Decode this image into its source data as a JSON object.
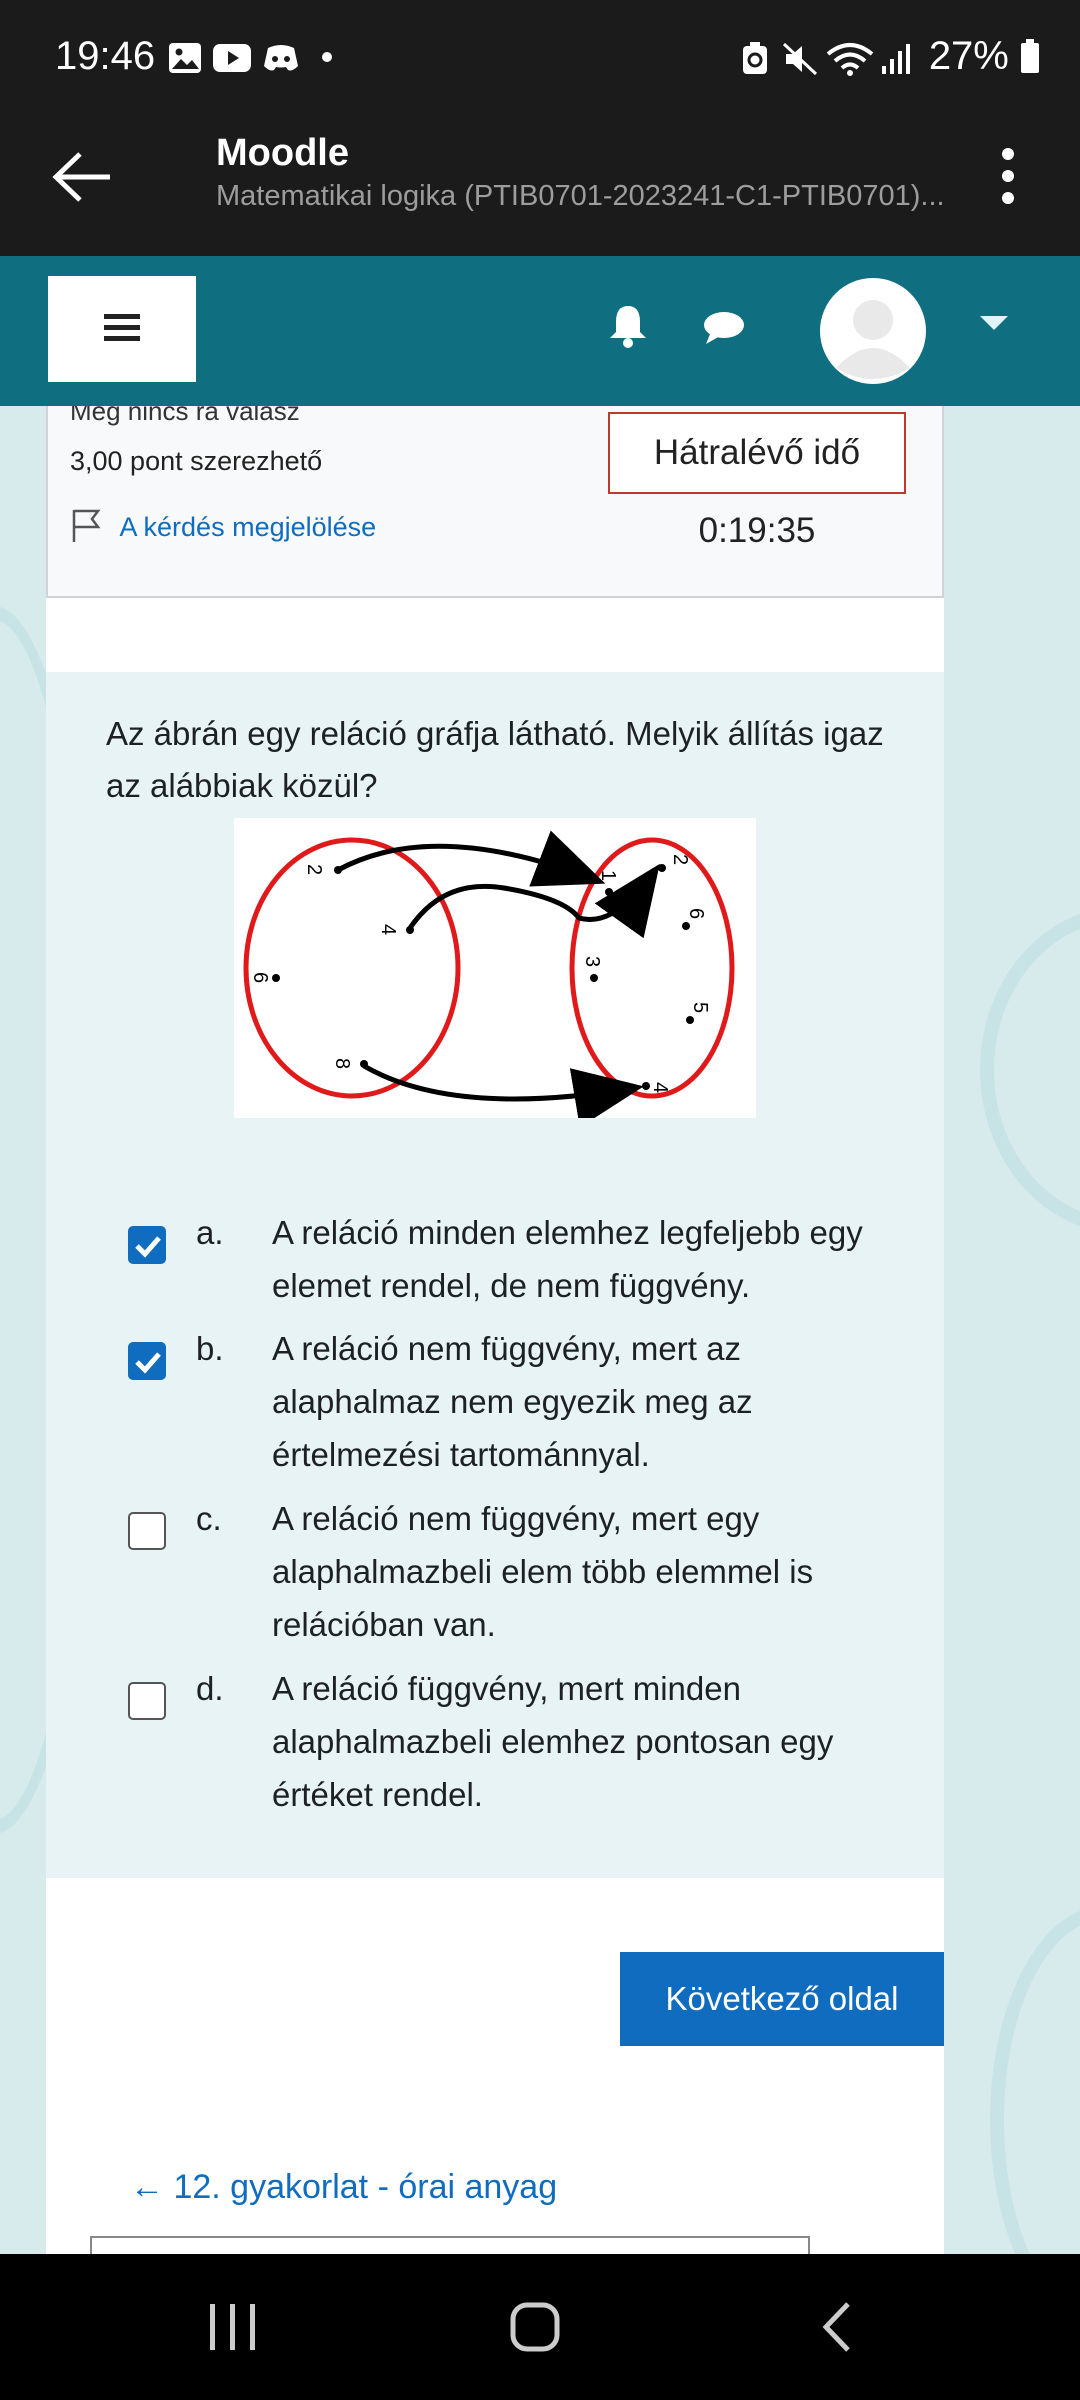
{
  "status_bar": {
    "time": "19:46",
    "battery": "27%",
    "icons": [
      "gallery-icon",
      "youtube-icon",
      "discord-icon",
      "dot-icon",
      "battery-saver-icon",
      "mute-icon",
      "wifi-icon",
      "signal-icon",
      "battery-icon"
    ]
  },
  "app_bar": {
    "title": "Moodle",
    "subtitle": "Matematikai logika (PTIB0701-2023241-C1-PTIB0701)..."
  },
  "navbar": {
    "icons": [
      "hamburger-icon",
      "bell-icon",
      "chat-icon",
      "avatar",
      "caret-down-icon"
    ]
  },
  "question_info": {
    "status": "Még nincs rá válasz",
    "points": "3,00 pont szerezhető",
    "flag": "A kérdés megjelölése",
    "timer": "Hátralévő idő 0:19:35"
  },
  "question": {
    "text": "Az ábrán egy reláció gráfja látható. Melyik állítás igaz az alábbiak közül?",
    "graph": {
      "left_nodes": [
        "2",
        "4",
        "6",
        "8"
      ],
      "right_nodes": [
        "1",
        "2",
        "3",
        "4",
        "5",
        "6"
      ]
    }
  },
  "answers": [
    {
      "letter": "a.",
      "text": "A reláció minden elemhez legfeljebb egy elemet rendel, de nem függvény.",
      "checked": true
    },
    {
      "letter": "b.",
      "text": "A reláció nem függvény, mert az alaphalmaz nem egyezik meg az értelmezési tartománnyal.",
      "checked": true
    },
    {
      "letter": "c.",
      "text": "A reláció nem függvény, mert egy alaphalmazbeli elem több elemmel is relációban van.",
      "checked": false
    },
    {
      "letter": "d.",
      "text": "A reláció függvény, mert minden alaphalmazbeli elemhez pontosan egy értéket rendel.",
      "checked": false
    }
  ],
  "buttons": {
    "next": "Következő oldal",
    "prev_link": "← 12. gyakorlat - órai  anyag"
  },
  "colors": {
    "navbar": "#0f6e80",
    "accent": "#0f6cbf",
    "timer_border": "#c0392b"
  }
}
